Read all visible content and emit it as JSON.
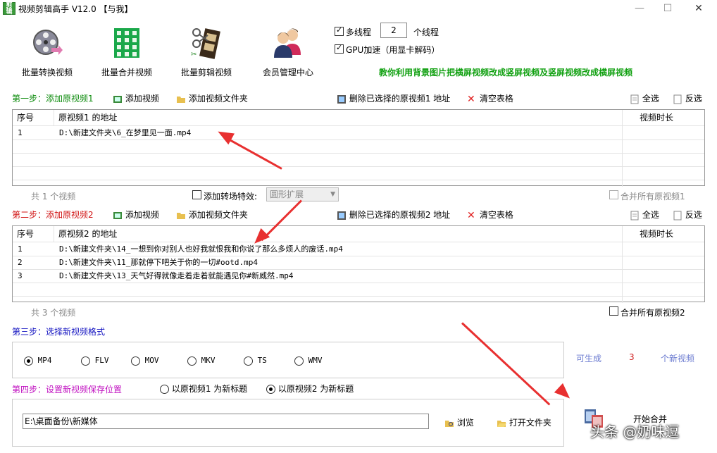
{
  "window": {
    "title": "视频剪辑高手 V12.0  【与我】",
    "app_icon_text": "剪辑",
    "min_label": "—",
    "max_label": "☐",
    "close_label": "✕"
  },
  "toolbar": {
    "items": [
      {
        "label": "批量转换视频",
        "icon": "film-reel-icon"
      },
      {
        "label": "批量合并视频",
        "icon": "building-grid-icon"
      },
      {
        "label": "批量剪辑视频",
        "icon": "film-scissors-icon"
      },
      {
        "label": "会员管理中心",
        "icon": "users-icon"
      }
    ],
    "multithread_label": "多线程",
    "thread_count": "2",
    "thread_unit": "个线程",
    "gpu_label": "GPU加速（用显卡解码）",
    "promo_link": "教你利用背景图片把横屏视频改成竖屏视频及竖屏视频改成横屏视频"
  },
  "step1": {
    "title": "第一步：添加原视频1",
    "add_video": "添加视频",
    "add_folder": "添加视频文件夹",
    "delete_selected": "删除已选择的原视频1 地址",
    "clear_table": "清空表格",
    "select_all": "全选",
    "invert": "反选",
    "columns": {
      "index": "序号",
      "path": "原视频1 的地址",
      "duration": "视频时长"
    },
    "rows": [
      {
        "index": "1",
        "path": "D:\\新建文件夹\\6_在梦里见一面.mp4",
        "duration": ""
      }
    ],
    "count_text": "共 1 个视频",
    "transition_label": "添加转场特效:",
    "transition_value": "圆形扩展",
    "merge_all": "合并所有原视频1"
  },
  "step2": {
    "title": "第二步：添加原视频2",
    "add_video": "添加视频",
    "add_folder": "添加视频文件夹",
    "delete_selected": "删除已选择的原视频2 地址",
    "clear_table": "清空表格",
    "select_all": "全选",
    "invert": "反选",
    "columns": {
      "index": "序号",
      "path": "原视频2 的地址",
      "duration": "视频时长"
    },
    "rows": [
      {
        "index": "1",
        "path": "D:\\新建文件夹\\14_一想到你对别人也好我就恨我和你说了那么多烦人的废话.mp4",
        "duration": ""
      },
      {
        "index": "2",
        "path": "D:\\新建文件夹\\11_那就停下吧关于你的一切#ootd.mp4",
        "duration": ""
      },
      {
        "index": "3",
        "path": "D:\\新建文件夹\\13_天气好得就像走着走着就能遇见你#新威然.mp4",
        "duration": ""
      }
    ],
    "count_text": "共 3 个视频",
    "merge_all": "合并所有原视频2"
  },
  "step3": {
    "title": "第三步：选择新视频格式",
    "formats": [
      "MP4",
      "FLV",
      "MOV",
      "MKV",
      "TS",
      "WMV"
    ],
    "selected_format": "MP4",
    "can_generate": "可生成",
    "generate_count": "3",
    "generate_unit": "个新视频"
  },
  "step4": {
    "title": "第四步：设置新视频保存位置",
    "option1": "以原视频1 为新标题",
    "option2": "以原视频2 为新标题",
    "selected_option": 2,
    "save_path": "E:\\桌面备份\\新媒体",
    "browse": "浏览",
    "open_folder": "打开文件夹",
    "start_merge": "开始合并"
  },
  "watermark": "头条 @奶味逗",
  "colors": {
    "green_step": "#0a8a0a",
    "red_step": "#d01010",
    "blue_step": "#1010c0",
    "magenta_step": "#c010c0",
    "promo": "#10a010",
    "arrow": "#e83030"
  }
}
